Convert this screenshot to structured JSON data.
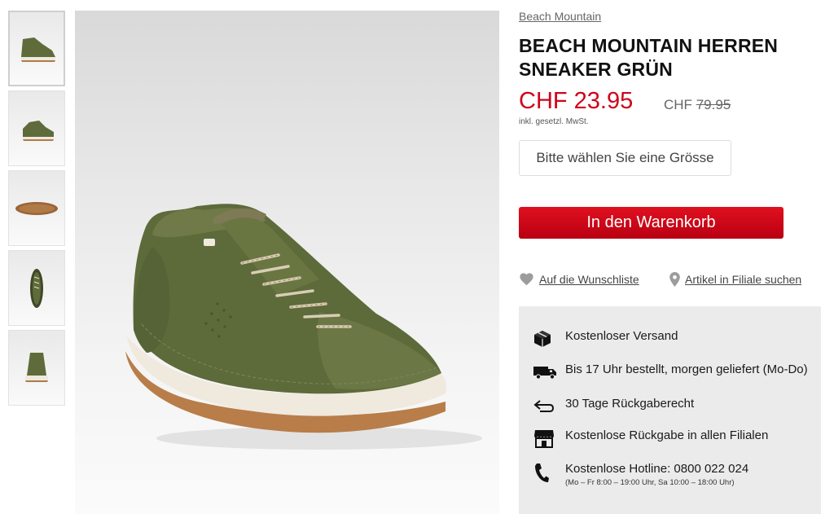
{
  "thumbnails": [
    {
      "label": "side view",
      "icon": "shoe-side-thumbnail"
    },
    {
      "label": "outer side",
      "icon": "shoe-outer-thumbnail"
    },
    {
      "label": "sole",
      "icon": "shoe-sole-thumbnail"
    },
    {
      "label": "top view",
      "icon": "shoe-top-thumbnail"
    },
    {
      "label": "back view",
      "icon": "shoe-back-thumbnail"
    }
  ],
  "product": {
    "brand": "Beach Mountain",
    "title": "BEACH MOUNTAIN HERREN SNEAKER GRÜN",
    "price": "CHF 23.95",
    "old_price_currency": "CHF",
    "old_price_value": "79.95",
    "vat_note": "inkl. gesetzl. MwSt."
  },
  "actions": {
    "size_placeholder": "Bitte wählen Sie eine Grösse",
    "add_to_cart": "In den Warenkorb",
    "wishlist": "Auf die Wunschliste",
    "find_in_store": "Artikel in Filiale suchen"
  },
  "info": {
    "shipping": "Kostenloser Versand",
    "delivery": "Bis 17 Uhr bestellt, morgen geliefert (Mo-Do)",
    "returns": "30 Tage Rückgaberecht",
    "store_returns": "Kostenlose Rückgabe in allen Filialen",
    "hotline": "Kostenlose Hotline: 0800 022 024",
    "hotline_hours": "(Mo – Fr 8:00 – 19:00 Uhr, Sa 10:00 – 18:00 Uhr)"
  },
  "colors": {
    "price_red": "#d0021b",
    "button_red": "#c8071a",
    "shoe_olive": "#5d6a3a",
    "info_bg": "#ebebeb"
  }
}
